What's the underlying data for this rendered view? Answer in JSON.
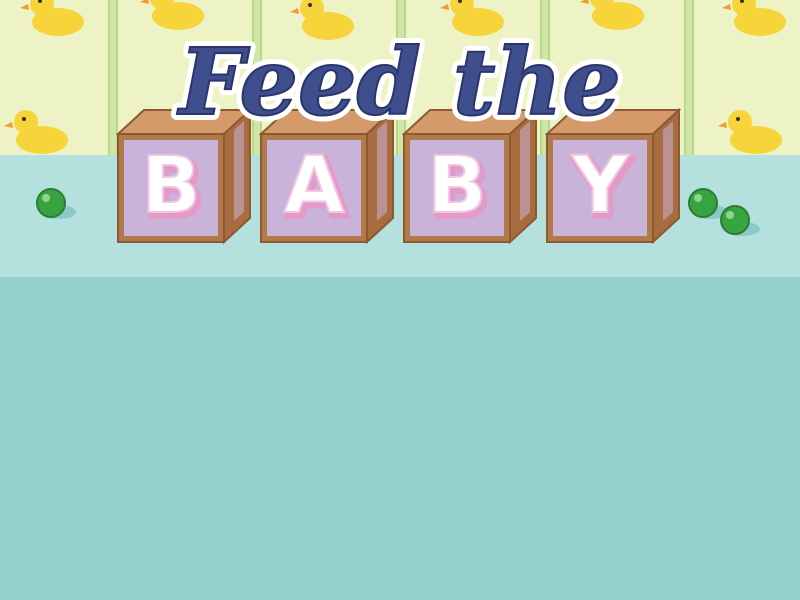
{
  "game": {
    "title_line1": "Feed the",
    "blocks": [
      "B",
      "A",
      "B",
      "Y"
    ]
  },
  "colors": {
    "wallpaper": "#eef3c6",
    "stripe": "#cfe6a6",
    "table": "#b4e0de",
    "floor": "#93d1cb",
    "title_fill": "#3f4f8e",
    "block_face": "#c9b3d9",
    "block_wood": "#b27a4a",
    "letter_fill": "#ffffff",
    "letter_shadow": "#e49ac8",
    "pea": "#3aa341",
    "duck": "#f6d43a"
  },
  "icons": [
    "rubber-duck-icon",
    "pea-icon"
  ]
}
